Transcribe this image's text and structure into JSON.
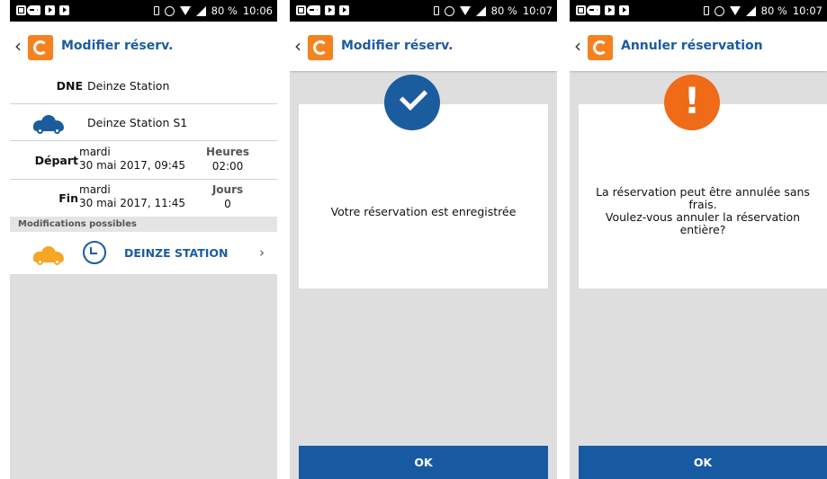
{
  "status_left": [
    {
      "icon": "gallery-icon"
    },
    {
      "icon": "youtube-icon"
    },
    {
      "icon": "youtube-icon"
    },
    {
      "icon": "youtube-icon"
    },
    {
      "icon": "messenger-icon"
    }
  ],
  "screens": [
    {
      "status": {
        "battery": "80 %",
        "time": "10:06"
      },
      "title": "Modifier réserv.",
      "station_code": "DNE",
      "station_name": "Deinze Station",
      "car_location": "Deinze Station S1",
      "depart_label": "Départ",
      "depart_day": "mardi",
      "depart_date": "30 mai 2017, 09:45",
      "heures_label": "Heures",
      "heures_value": "02:00",
      "fin_label": "Fin",
      "fin_day": "mardi",
      "fin_date": "30 mai 2017, 11:45",
      "jours_label": "Jours",
      "jours_value": "0",
      "modifications_label": "Modifications possibles",
      "modification_link": "DEINZE STATION",
      "colors": {
        "car_blue": "#1b5c9e",
        "car_orange": "#f5a623"
      }
    },
    {
      "status": {
        "battery": "80 %",
        "time": "10:07"
      },
      "title": "Modifier réserv.",
      "message": "Votre réservation est enregistrée",
      "ok_label": "OK"
    },
    {
      "status": {
        "battery": "80 %",
        "time": "10:07"
      },
      "title": "Annuler réservation",
      "message_lines": [
        "La réservation peut être annulée sans",
        "frais.",
        "Voulez-vous annuler la réservation",
        "entière?"
      ],
      "ok_label": "OK"
    }
  ],
  "colors": {
    "primary": "#1b5c9e",
    "brand_orange": "#f5811f",
    "warning": "#ef6b17",
    "button": "#175aa1"
  }
}
